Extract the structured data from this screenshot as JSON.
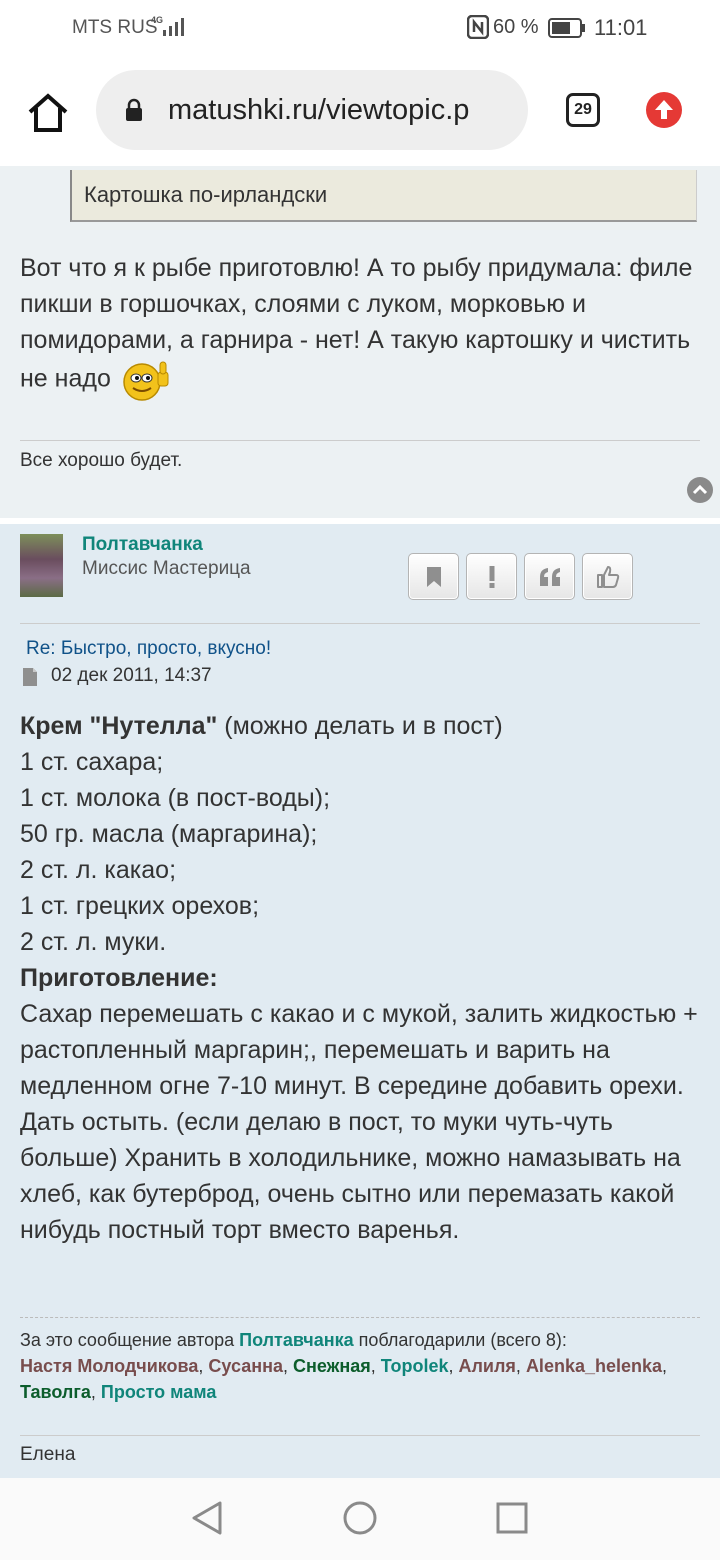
{
  "status_bar": {
    "carrier": "MTS RUS",
    "network": "4G",
    "battery": "60 %",
    "time": "11:01"
  },
  "browser": {
    "url": "matushki.ru/viewtopic.p",
    "tab_count": "29"
  },
  "post1": {
    "quote": "Картошка по-ирландски",
    "body": "Вот что я к рыбе приготовлю! А то рыбу придумала: филе пикши в горшочках, слоями с луком, морковью и помидорами, а гарнира - нет! А такую картошку и чистить не надо",
    "signature": "Все хорошо будет."
  },
  "post2": {
    "author": "Полтавчанка",
    "rank": "Миссис Мастерица",
    "title": "Re: Быстро, просто, вкусно!",
    "date": "02 дек 2011, 14:37",
    "heading_bold": "Крем \"Нутелла\"",
    "heading_rest": " (можно делать и в пост)",
    "ingredients": [
      "1 ст. сахара;",
      "1 ст. молока (в пост-воды);",
      "50 гр. масла (маргарина);",
      "2 ст. л. какао;",
      "1 ст. грецких орехов;",
      "2 ст. л. муки."
    ],
    "method_label": "Приготовление:",
    "method_text": "Сахар перемешать с какао и с мукой, залить жидкостью + растопленный маргарин;, перемешать и варить на медленном огне 7-10 минут. В середине добавить орехи. Дать остыть. (если делаю в пост, то муки чуть-чуть больше) Хранить в холодильнике, можно намазывать на хлеб, как бутерброд, очень сытно или перемазать какой нибудь постный торт вместо варенья.",
    "thanks_prefix": "За это сообщение автора ",
    "thanks_author": "Полтавчанка",
    "thanks_suffix": " поблагодарили (всего 8):",
    "thanked_users": [
      {
        "name": "Настя Молодчикова",
        "color": "#784d4d"
      },
      {
        "name": "Сусанна",
        "color": "#784d4d"
      },
      {
        "name": "Снежная",
        "color": "#0c5d2c"
      },
      {
        "name": "Topolek",
        "color": "#10857a"
      },
      {
        "name": "Алиля",
        "color": "#784d4d"
      },
      {
        "name": "Alenka_helenka",
        "color": "#784d4d"
      },
      {
        "name": "Таволга",
        "color": "#0c5d2c"
      },
      {
        "name": "Просто мама",
        "color": "#10857a"
      }
    ],
    "signature": "Елена"
  },
  "icons": [
    "home-icon",
    "lock-icon",
    "tabs-icon",
    "upload-icon",
    "bookmark-icon",
    "report-icon",
    "quote-icon",
    "thumbs-up-icon",
    "back-to-top-icon",
    "back-icon",
    "home-circle-icon",
    "recents-icon"
  ]
}
